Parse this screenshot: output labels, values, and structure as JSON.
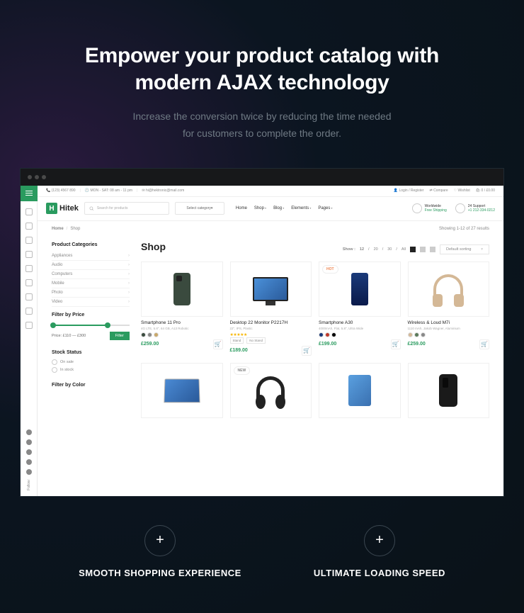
{
  "hero": {
    "title_l1": "Empower your product catalog with",
    "title_l2": "modern AJAX technology",
    "sub_l1": "Increase the conversion twice by reducing the time needed",
    "sub_l2": "for customers to complete the order."
  },
  "topbar": {
    "phone": "(123) 4567 890",
    "hours": "MON - SAT: 08 am - 11 pm",
    "email": "hi@hektronic@mail.com",
    "login": "Login / Register",
    "compare": "Compare",
    "wishlist": "Wishlist",
    "cart": "0 / £0.00"
  },
  "logo": {
    "mark": "H",
    "text": "Hitek"
  },
  "search": {
    "placeholder": "Search for products"
  },
  "cat_select": "Select category",
  "nav": [
    "Home",
    "Shop",
    "Blog",
    "Elements",
    "Pages"
  ],
  "shipping": [
    {
      "t1": "Worldwide",
      "t2": "Free Shipping"
    },
    {
      "t1": "24 Support",
      "t2": "+1 212-334-0212"
    }
  ],
  "breadcrumb": {
    "home": "Home",
    "current": "Shop"
  },
  "results": "Showing 1-12 of 27 results",
  "sidebar": {
    "cat_head": "Product Categories",
    "cats": [
      "Appliances",
      "Audio",
      "Computers",
      "Mobile",
      "Photo",
      "Video"
    ],
    "price_head": "Filter by Price",
    "price_label": "Price: £110 — £300",
    "filter_btn": "Filter",
    "stock_head": "Stock Status",
    "stock": [
      "On sale",
      "In stock"
    ],
    "color_head": "Filter by Color"
  },
  "catalog": {
    "title": "Shop",
    "show_label": "Show :",
    "show_opts": [
      "12",
      "20",
      "30",
      "All"
    ],
    "sort": "Default sorting"
  },
  "products": [
    {
      "name": "Smartphone 11 Pro",
      "meta": "4G LTE, 5.8\", 64 GB, A13 Robotic",
      "price": "£259.00",
      "swatches": [
        "#3a4a3e",
        "#888",
        "#c9a86a"
      ]
    },
    {
      "name": "Desktop 22 Monitor P2217H",
      "meta": "22\", IPS, Plastic",
      "price": "£189.00",
      "stars": "★★★★★",
      "opts": [
        "Stand",
        "No Stand"
      ]
    },
    {
      "name": "Smartphone A30",
      "meta": "4000mAh, Flat, 5.8\", Ultra Wide",
      "price": "£199.00",
      "badge": "HOT",
      "swatches": [
        "#1a3a7a",
        "#c0392b",
        "#000"
      ]
    },
    {
      "name": "Wireless & Loud M7i",
      "meta": "1110 mAh, Jakob Wagner, Aluminium",
      "price": "£259.00",
      "swatches": [
        "#d4b896",
        "#5a7a5a",
        "#888"
      ]
    }
  ],
  "products2_badge": "NEW",
  "features": [
    {
      "label": "SMOOTH SHOPPING EXPERIENCE"
    },
    {
      "label": "ULTIMATE LOADING SPEED"
    }
  ],
  "follow": "Follow:"
}
